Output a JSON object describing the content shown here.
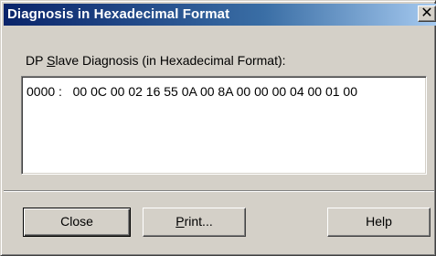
{
  "window": {
    "title": "Diagnosis in Hexadecimal Format",
    "close_glyph": "✕"
  },
  "group": {
    "label_prefix": "DP ",
    "label_mnemonic": "S",
    "label_rest": "lave Diagnosis (in Hexadecimal Format):"
  },
  "hex": {
    "offset": "0000 :",
    "bytes": "00 0C 00 02 16 55 0A 00 8A 00 00 00 04 00 01 00"
  },
  "buttons": {
    "close_label": "Close",
    "print_mnemonic": "P",
    "print_rest": "rint...",
    "help_label": "Help"
  }
}
